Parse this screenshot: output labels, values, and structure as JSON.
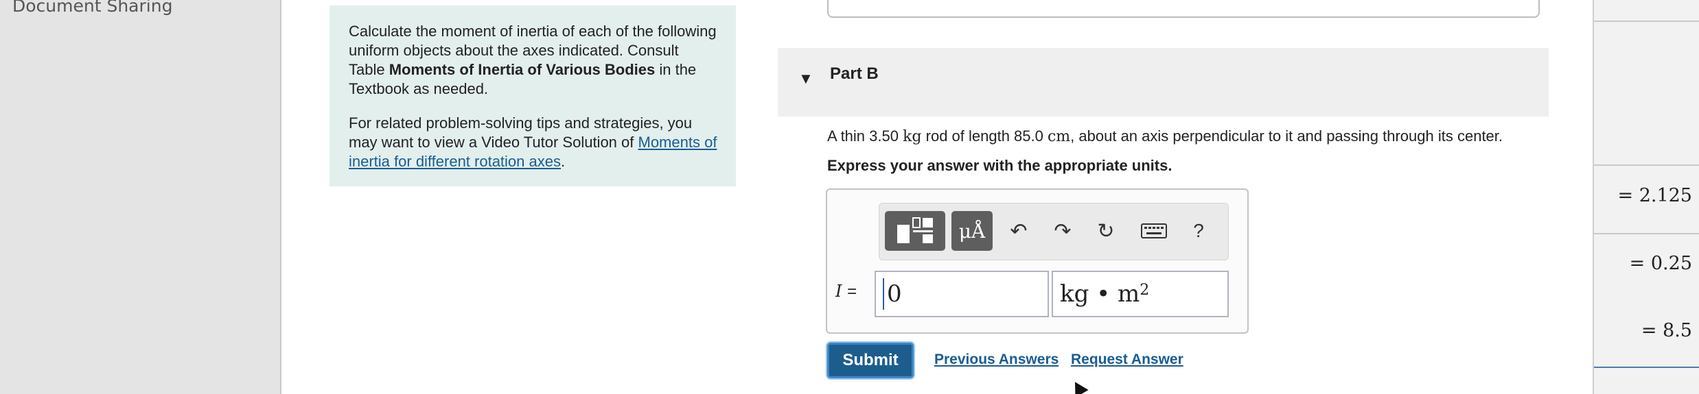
{
  "sidebar": {
    "title": "Document Sharing"
  },
  "intro": {
    "p1_before": "Calculate the moment of inertia of each of the following uniform objects about the axes indicated. Consult Table ",
    "p1_bold": "Moments of Inertia of Various Bodies",
    "p1_after": " in the Textbook as needed.",
    "p2_text": "For related problem-solving tips and strategies, you may want to view a Video Tutor Solution of ",
    "p2_link": "Moments of inertia for different rotation axes",
    "p2_end": "."
  },
  "part": {
    "title": "Part B"
  },
  "question": {
    "prefix": "A thin 3.50 ",
    "mass_unit": "kg",
    "middle": " rod of length 85.0 ",
    "length_unit": "cm",
    "suffix": ", about an axis perpendicular to it and passing through its center.",
    "instruction": "Express your answer with the appropriate units."
  },
  "answer": {
    "variable": "I",
    "equals": "=",
    "value": "0",
    "unit_base": "kg • m",
    "unit_exp": "2"
  },
  "toolbar": {
    "units_label": "μÅ",
    "help_label": "?"
  },
  "actions": {
    "submit": "Submit",
    "previous_answers": "Previous Answers",
    "request_answer": "Request Answer"
  },
  "side_values": [
    "= 2.125",
    "= 0.25",
    "= 8.5"
  ],
  "colors": {
    "link": "#1a5c93",
    "submit_bg": "#1c5d8e",
    "intro_bg": "#e3efed"
  }
}
